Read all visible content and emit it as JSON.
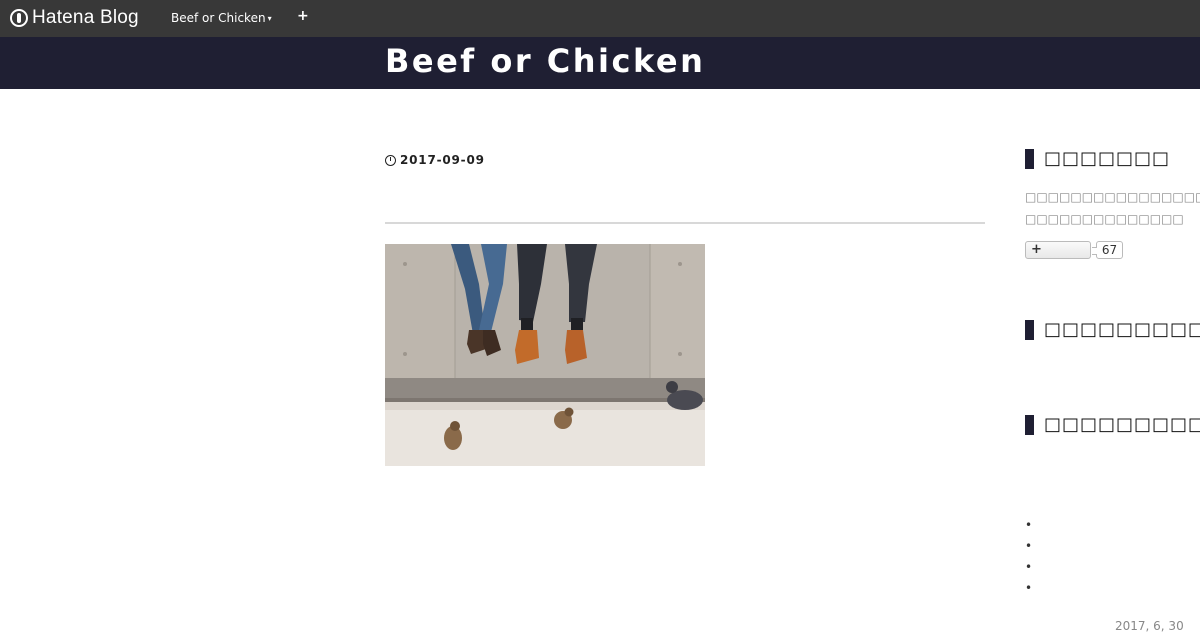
{
  "topbar": {
    "logo_text": "Hatena Blog",
    "blog_menu_label": "Beef or Chicken",
    "add_label": "+"
  },
  "header": {
    "title": "Beef or Chicken"
  },
  "entry": {
    "date": "2017-09-09"
  },
  "sidebar": {
    "profile_heading": "□□□□□□□",
    "about_lines": [
      "□□□□□□□□□□□□□□□□□□□□□□□□□□",
      "□□□□□□□□□□□□□□"
    ],
    "subscribe_label": "+",
    "subscriber_count": "67",
    "search_heading": "□□□□□□□□□",
    "recent_heading": "□□□□□□□□□□□□",
    "list_items": [
      "",
      "",
      "",
      ""
    ],
    "bottom_date": "2017, 6, 30"
  },
  "colors": {
    "topbar": "#383838",
    "header": "#1f1f33",
    "accent": "#1f1f33"
  }
}
